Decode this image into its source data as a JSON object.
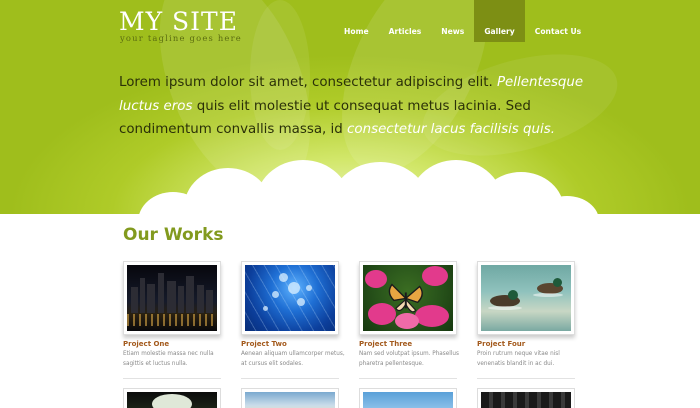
{
  "site": {
    "title": "MY SITE",
    "tagline": "your tagline goes here"
  },
  "nav": {
    "items": [
      {
        "label": "Home"
      },
      {
        "label": "Articles"
      },
      {
        "label": "News"
      },
      {
        "label": "Gallery",
        "active": true
      },
      {
        "label": "Contact Us"
      }
    ]
  },
  "intro": {
    "part1": "Lorem ipsum dolor sit amet, consectetur adipiscing elit. ",
    "em1": "Pellentesque luctus eros",
    "part2": " quis elit molestie ut consequat metus lacinia. Sed condimentum convallis massa, id ",
    "em2": "consectetur lacus facilisis quis."
  },
  "works": {
    "title": "Our Works",
    "projects": [
      {
        "title": "Project One",
        "desc": "Etiam molestie massa nec nulla sagittis et luctus nulla."
      },
      {
        "title": "Project Two",
        "desc": "Aenean aliquam ullamcorper metus, at cursus elit sodales."
      },
      {
        "title": "Project Three",
        "desc": "Nam sed volutpat ipsum. Phasellus pharetra pellentesque."
      },
      {
        "title": "Project Four",
        "desc": "Proin rutrum neque vitae nisl venenatis blandit in ac dui."
      }
    ]
  },
  "colors": {
    "accent_green": "#afcb28",
    "title_green": "#829a1e",
    "project_title": "#a35a1d",
    "nav_active": "#7d8f14"
  }
}
